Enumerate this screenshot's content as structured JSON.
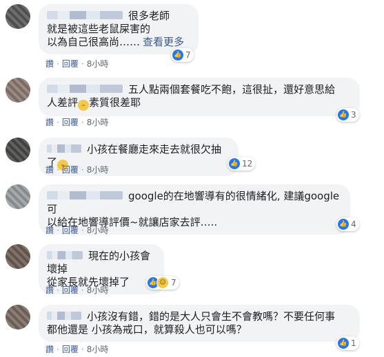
{
  "actions": {
    "like": "讚",
    "reply": "回覆",
    "sep": "·"
  },
  "comments": [
    {
      "avatar_color": "#5a5a5a",
      "lines": [
        "很多老師",
        "就是被這些老鼠屎害的",
        "以為自己很高尚……"
      ],
      "more": "查看更多",
      "reaction_icons": [
        "like-icon"
      ],
      "reaction_count": "7",
      "time": "8小時"
    },
    {
      "avatar_color": "#8b7b72",
      "lines": [
        "五人點兩個套餐吃不飽，這很扯，還好意思給",
        "人差評",
        "素質很差耶"
      ],
      "reaction_icons": [
        "like-icon"
      ],
      "reaction_count": "3",
      "time": "8小時"
    },
    {
      "avatar_color": "#4a4a48",
      "lines": [
        "小孩在餐廳走來走去就很欠抽了"
      ],
      "reaction_icons": [
        "like-icon"
      ],
      "reaction_count": "12",
      "time": "8小時"
    },
    {
      "avatar_color": "#9a9d9f",
      "lines": [
        "google的在地響導有的很情緒化, 建議google可",
        "以給在地響導評價~就讓店家去評….."
      ],
      "reaction_icons": [
        "like-icon"
      ],
      "reaction_count": "4",
      "time": "8小時"
    },
    {
      "avatar_color": "#6e5f55",
      "lines": [
        "現在的小孩會壞掉",
        "從家長就先壞掉了"
      ],
      "reaction_icons": [
        "like-icon",
        "haha-icon"
      ],
      "reaction_count": "7",
      "time": "8小時"
    },
    {
      "avatar_color": "#7a6b62",
      "lines": [
        "小孩沒有錯，錯的是大人只會生不會教嗎？不要任何事",
        "都他還是 小孩為戒口，就算殺人也可以嗎？"
      ],
      "reaction_icons": [
        "like-icon"
      ],
      "reaction_count": "1",
      "time": "8小時"
    }
  ]
}
